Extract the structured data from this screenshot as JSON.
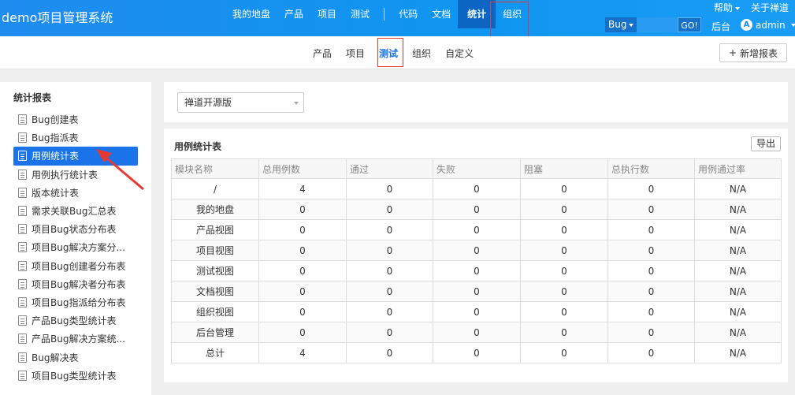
{
  "brand": "demo项目管理系统",
  "main_nav": [
    "我的地盘",
    "产品",
    "项目",
    "测试",
    "代码",
    "文档",
    "统计",
    "组织"
  ],
  "main_nav_active": "统计",
  "top_right": {
    "help": "帮助",
    "about": "关于禅道"
  },
  "search": {
    "type": "Bug",
    "go": "GO!"
  },
  "backstage": "后台",
  "user": {
    "avatar_letter": "A",
    "name": "admin"
  },
  "sub_nav": [
    "产品",
    "项目",
    "测试",
    "组织",
    "自定义"
  ],
  "sub_nav_active": "测试",
  "new_report": "新增报表",
  "sidebar": {
    "title": "统计报表",
    "items": [
      "Bug创建表",
      "Bug指派表",
      "用例统计表",
      "用例执行统计表",
      "版本统计表",
      "需求关联Bug汇总表",
      "项目Bug状态分布表",
      "项目Bug解决方案分...",
      "项目Bug创建者分布表",
      "项目Bug解决者分布表",
      "项目Bug指派给分布表",
      "产品Bug类型统计表",
      "产品Bug解决方案统...",
      "Bug解决表",
      "项目Bug类型统计表"
    ],
    "active_index": 2
  },
  "product_select": "禅道开源版",
  "report": {
    "title": "用例统计表",
    "export": "导出",
    "columns": [
      "模块名称",
      "总用例数",
      "通过",
      "失败",
      "阻塞",
      "总执行数",
      "用例通过率"
    ],
    "rows": [
      [
        "/",
        "4",
        "0",
        "0",
        "0",
        "0",
        "N/A"
      ],
      [
        "我的地盘",
        "0",
        "0",
        "0",
        "0",
        "0",
        "N/A"
      ],
      [
        "产品视图",
        "0",
        "0",
        "0",
        "0",
        "0",
        "N/A"
      ],
      [
        "项目视图",
        "0",
        "0",
        "0",
        "0",
        "0",
        "N/A"
      ],
      [
        "测试视图",
        "0",
        "0",
        "0",
        "0",
        "0",
        "N/A"
      ],
      [
        "文档视图",
        "0",
        "0",
        "0",
        "0",
        "0",
        "N/A"
      ],
      [
        "组织视图",
        "0",
        "0",
        "0",
        "0",
        "0",
        "N/A"
      ],
      [
        "后台管理",
        "0",
        "0",
        "0",
        "0",
        "0",
        "N/A"
      ],
      [
        "总计",
        "4",
        "0",
        "0",
        "0",
        "0",
        "N/A"
      ]
    ]
  },
  "colors": {
    "header": "#1a91f0",
    "accent": "#1a73e8",
    "highlight_box": "#e53935"
  }
}
